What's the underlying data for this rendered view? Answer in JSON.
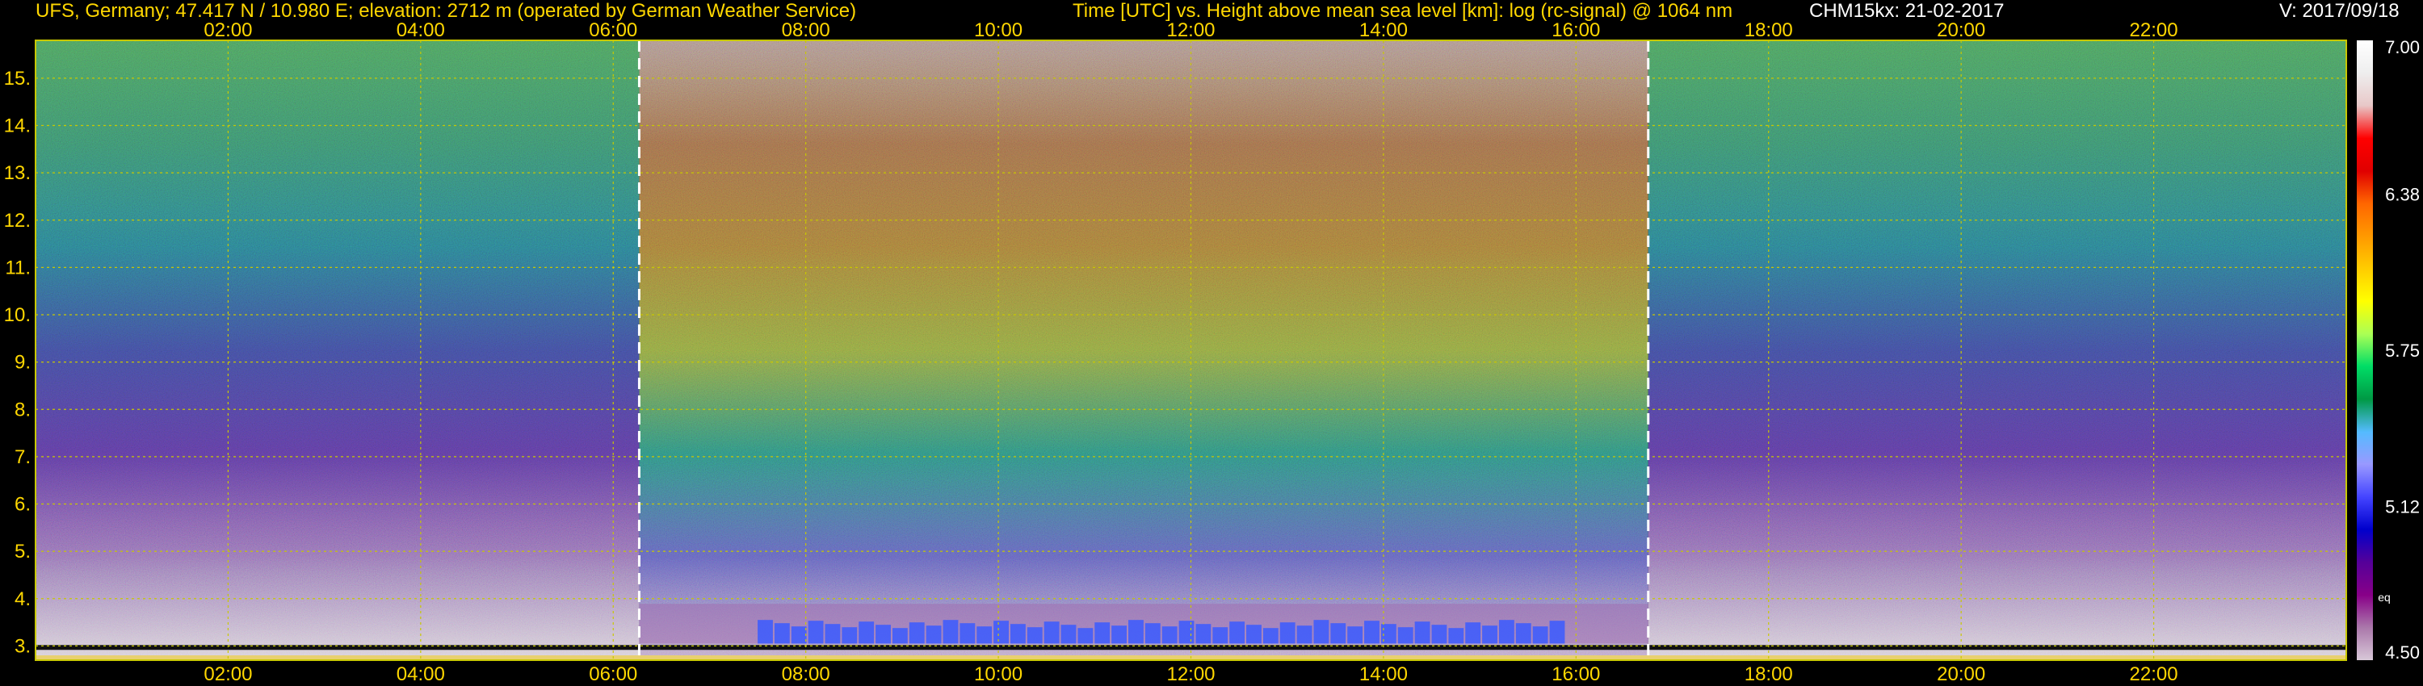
{
  "header": {
    "station": "UFS, Germany; 47.417 N / 10.980 E; elevation: 2712 m  (operated by German Weather Service)",
    "plot_title": "Time [UTC] vs. Height above mean sea level [km]: log (rc-signal) @ 1064 nm",
    "instrument_date": "CHM15kx: 21-02-2017",
    "version": "V: 2017/09/18"
  },
  "colors": {
    "header_left": "#ffd700",
    "header_white": "#ffffff",
    "grid": "#c8c800",
    "daylight_marker": "#ffffff"
  },
  "chart_data": {
    "type": "heatmap",
    "title": "Time [UTC] vs. Height above mean sea level [km]: log (rc-signal) @ 1064 nm",
    "xlabel": "Time [UTC]",
    "ylabel": "Height above mean sea level [km]",
    "x_ticks": [
      "02:00",
      "04:00",
      "06:00",
      "08:00",
      "10:00",
      "12:00",
      "14:00",
      "16:00",
      "18:00",
      "20:00",
      "22:00"
    ],
    "x_tick_hours": [
      2,
      4,
      6,
      8,
      10,
      12,
      14,
      16,
      18,
      20,
      22
    ],
    "xlim_hours": [
      0,
      24
    ],
    "y_ticks": [
      "3.",
      "4.",
      "5.",
      "6.",
      "7.",
      "8.",
      "9.",
      "10.",
      "11.",
      "12.",
      "13.",
      "14.",
      "15."
    ],
    "y_tick_values": [
      3,
      4,
      5,
      6,
      7,
      8,
      9,
      10,
      11,
      12,
      13,
      14,
      15
    ],
    "ylim_km": [
      2.7,
      15.8
    ],
    "grid": true,
    "daylight_markers_hours": [
      6.27,
      16.75
    ],
    "colorbar": {
      "labels": [
        "7.00",
        "6.38",
        "5.75",
        "5.12",
        "4.50"
      ],
      "values": [
        7.0,
        6.38,
        5.75,
        5.12,
        4.5
      ],
      "range": [
        4.5,
        7.0
      ],
      "side_label": "eq",
      "colors_top_to_bottom": [
        "#ffffff",
        "#eeeeee",
        "#e8c8c8",
        "#ff0000",
        "#e00000",
        "#ff6600",
        "#ff9900",
        "#ffcc00",
        "#ffff00",
        "#aaff55",
        "#00dd66",
        "#009944",
        "#55bbff",
        "#9999ff",
        "#4444ff",
        "#0000cc",
        "#550099",
        "#880088",
        "#aa77aa",
        "#d8c8d8"
      ]
    },
    "zones": [
      {
        "name": "night",
        "from_hour": 0,
        "to_hour": 6.27,
        "bottom_to_top": [
          "#d8d0d8",
          "#9070b0",
          "#5a3a9a",
          "#3f4a98",
          "#2a7a8a",
          "#3a8a6a",
          "#4a9a5a"
        ]
      },
      {
        "name": "day",
        "from_hour": 6.27,
        "to_hour": 16.75,
        "bottom_to_top": [
          "#c0a8c8",
          "#6060b8",
          "#2e8a7a",
          "#8aa040",
          "#a07838",
          "#9a6a48",
          "#a89088"
        ]
      },
      {
        "name": "night",
        "from_hour": 16.75,
        "to_hour": 24,
        "bottom_to_top": [
          "#d8d0d8",
          "#9070b0",
          "#5a3a9a",
          "#3f4a98",
          "#2a7a8a",
          "#3a8a6a",
          "#4a9a5a"
        ]
      }
    ],
    "cloud_layer_km": [
      3.05,
      3.55
    ],
    "cloud_layer_hours": [
      7.5,
      15.9
    ],
    "cloud_color": "#3a5aff"
  }
}
